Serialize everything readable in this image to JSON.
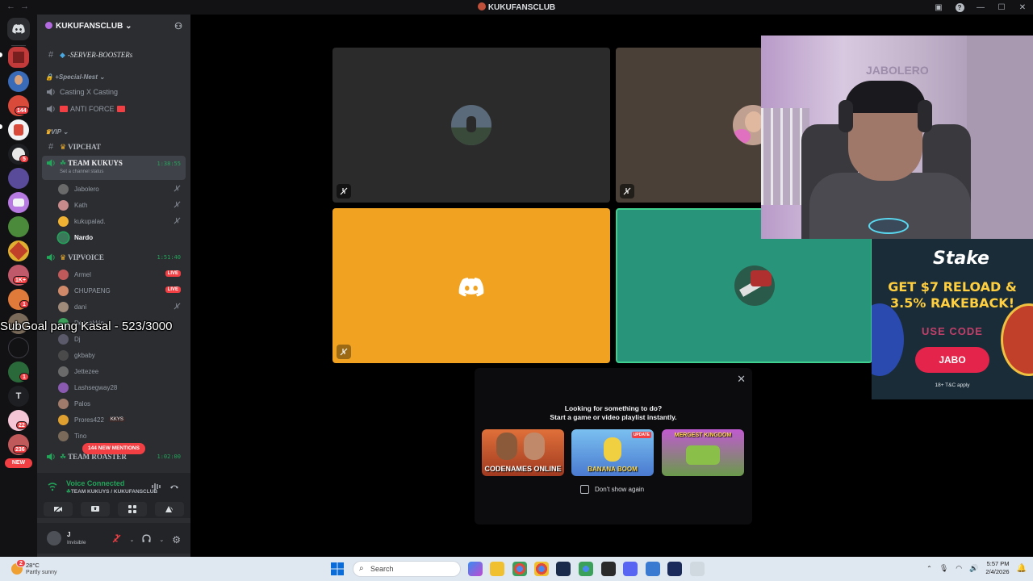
{
  "window": {
    "title": "KUKUFANSCLUB"
  },
  "server": {
    "name": "KUKUFANSCLUB"
  },
  "rail": {
    "badges": [
      "144",
      "5",
      "1K+",
      "1",
      "1",
      "22",
      "236"
    ],
    "letter_server": "T",
    "new_label": "NEW"
  },
  "channels": {
    "server_boosters": "-SERVER-BOOSTERs",
    "category_special_nest": "+Special-Nest",
    "casting": "Casting X Casting",
    "anti_force": "ANTI FORCE",
    "category_vip": "VIP",
    "vipchat": "VIPCHAT",
    "team_kukuys": {
      "name": "TEAM KUKUYS",
      "timer": "1:38:55",
      "status": "Set a channel status"
    },
    "team_kukuys_members": [
      "Jabolero",
      "Kath",
      "kukupalad.",
      "Nardo"
    ],
    "vipvoice": {
      "name": "VIPVOICE",
      "timer": "1:51:40"
    },
    "vipvoice_members": [
      "Armel",
      "CHUPAENG",
      "dani",
      "Dezzakkin",
      "Dj",
      "gkbaby",
      "Jettezee",
      "Lashsegway28",
      "Palos",
      "Prores422",
      "Tino"
    ],
    "live_label": "LIVE",
    "member_tag": "KKYS",
    "next_channel": {
      "name": "TEAM ROASTER",
      "timer": "1:02:00"
    },
    "mentions": "144 NEW MENTIONS"
  },
  "voice_panel": {
    "status": "Voice Connected",
    "location": "TEAM KUKUYS / KUKUFANSCLUB"
  },
  "user_panel": {
    "name": "J",
    "status": "Invisible"
  },
  "overlay": {
    "subgoal": "SubGoal pang Kasal - 523/3000"
  },
  "activity_popup": {
    "heading": "Looking for something to do?",
    "subheading": "Start a game or video playlist instantly.",
    "games": [
      "CODENAMES ONLINE",
      "BANANA BOOM",
      "MERGEST KINGDOM"
    ],
    "update_badge": "UPDATE",
    "dont_show": "Don't show again"
  },
  "ad": {
    "brand": "Stake",
    "headline_1": "GET $7 RELOAD &",
    "headline_2": "3.5% RAKEBACK!",
    "code_label": "USE CODE",
    "cta": "JABO",
    "terms": "18+ T&C apply"
  },
  "webcam": {
    "sign_text": "JABOLERO"
  },
  "taskbar": {
    "temperature": "28°C",
    "weather": "Partly sunny",
    "weather_alert": "2",
    "search_placeholder": "Search",
    "time": "5:57 PM",
    "date": "2/4/2026"
  },
  "colors": {
    "tile_dark_1": "#2b2b2b",
    "tile_dark_2": "#4a4038",
    "tile_yellow": "#f0a220",
    "tile_teal": "#28957a",
    "discord_green": "#23a55a",
    "discord_red": "#f23f43"
  }
}
